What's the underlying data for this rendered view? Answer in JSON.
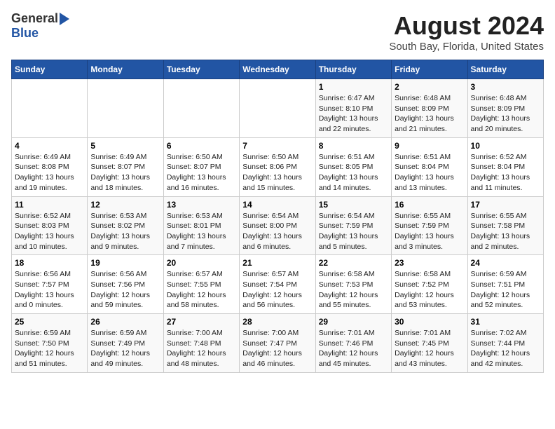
{
  "logo": {
    "general": "General",
    "blue": "Blue"
  },
  "title": "August 2024",
  "subtitle": "South Bay, Florida, United States",
  "days_of_week": [
    "Sunday",
    "Monday",
    "Tuesday",
    "Wednesday",
    "Thursday",
    "Friday",
    "Saturday"
  ],
  "weeks": [
    [
      {
        "day": "",
        "content": ""
      },
      {
        "day": "",
        "content": ""
      },
      {
        "day": "",
        "content": ""
      },
      {
        "day": "",
        "content": ""
      },
      {
        "day": "1",
        "content": "Sunrise: 6:47 AM\nSunset: 8:10 PM\nDaylight: 13 hours and 22 minutes."
      },
      {
        "day": "2",
        "content": "Sunrise: 6:48 AM\nSunset: 8:09 PM\nDaylight: 13 hours and 21 minutes."
      },
      {
        "day": "3",
        "content": "Sunrise: 6:48 AM\nSunset: 8:09 PM\nDaylight: 13 hours and 20 minutes."
      }
    ],
    [
      {
        "day": "4",
        "content": "Sunrise: 6:49 AM\nSunset: 8:08 PM\nDaylight: 13 hours and 19 minutes."
      },
      {
        "day": "5",
        "content": "Sunrise: 6:49 AM\nSunset: 8:07 PM\nDaylight: 13 hours and 18 minutes."
      },
      {
        "day": "6",
        "content": "Sunrise: 6:50 AM\nSunset: 8:07 PM\nDaylight: 13 hours and 16 minutes."
      },
      {
        "day": "7",
        "content": "Sunrise: 6:50 AM\nSunset: 8:06 PM\nDaylight: 13 hours and 15 minutes."
      },
      {
        "day": "8",
        "content": "Sunrise: 6:51 AM\nSunset: 8:05 PM\nDaylight: 13 hours and 14 minutes."
      },
      {
        "day": "9",
        "content": "Sunrise: 6:51 AM\nSunset: 8:04 PM\nDaylight: 13 hours and 13 minutes."
      },
      {
        "day": "10",
        "content": "Sunrise: 6:52 AM\nSunset: 8:04 PM\nDaylight: 13 hours and 11 minutes."
      }
    ],
    [
      {
        "day": "11",
        "content": "Sunrise: 6:52 AM\nSunset: 8:03 PM\nDaylight: 13 hours and 10 minutes."
      },
      {
        "day": "12",
        "content": "Sunrise: 6:53 AM\nSunset: 8:02 PM\nDaylight: 13 hours and 9 minutes."
      },
      {
        "day": "13",
        "content": "Sunrise: 6:53 AM\nSunset: 8:01 PM\nDaylight: 13 hours and 7 minutes."
      },
      {
        "day": "14",
        "content": "Sunrise: 6:54 AM\nSunset: 8:00 PM\nDaylight: 13 hours and 6 minutes."
      },
      {
        "day": "15",
        "content": "Sunrise: 6:54 AM\nSunset: 7:59 PM\nDaylight: 13 hours and 5 minutes."
      },
      {
        "day": "16",
        "content": "Sunrise: 6:55 AM\nSunset: 7:59 PM\nDaylight: 13 hours and 3 minutes."
      },
      {
        "day": "17",
        "content": "Sunrise: 6:55 AM\nSunset: 7:58 PM\nDaylight: 13 hours and 2 minutes."
      }
    ],
    [
      {
        "day": "18",
        "content": "Sunrise: 6:56 AM\nSunset: 7:57 PM\nDaylight: 13 hours and 0 minutes."
      },
      {
        "day": "19",
        "content": "Sunrise: 6:56 AM\nSunset: 7:56 PM\nDaylight: 12 hours and 59 minutes."
      },
      {
        "day": "20",
        "content": "Sunrise: 6:57 AM\nSunset: 7:55 PM\nDaylight: 12 hours and 58 minutes."
      },
      {
        "day": "21",
        "content": "Sunrise: 6:57 AM\nSunset: 7:54 PM\nDaylight: 12 hours and 56 minutes."
      },
      {
        "day": "22",
        "content": "Sunrise: 6:58 AM\nSunset: 7:53 PM\nDaylight: 12 hours and 55 minutes."
      },
      {
        "day": "23",
        "content": "Sunrise: 6:58 AM\nSunset: 7:52 PM\nDaylight: 12 hours and 53 minutes."
      },
      {
        "day": "24",
        "content": "Sunrise: 6:59 AM\nSunset: 7:51 PM\nDaylight: 12 hours and 52 minutes."
      }
    ],
    [
      {
        "day": "25",
        "content": "Sunrise: 6:59 AM\nSunset: 7:50 PM\nDaylight: 12 hours and 51 minutes."
      },
      {
        "day": "26",
        "content": "Sunrise: 6:59 AM\nSunset: 7:49 PM\nDaylight: 12 hours and 49 minutes."
      },
      {
        "day": "27",
        "content": "Sunrise: 7:00 AM\nSunset: 7:48 PM\nDaylight: 12 hours and 48 minutes."
      },
      {
        "day": "28",
        "content": "Sunrise: 7:00 AM\nSunset: 7:47 PM\nDaylight: 12 hours and 46 minutes."
      },
      {
        "day": "29",
        "content": "Sunrise: 7:01 AM\nSunset: 7:46 PM\nDaylight: 12 hours and 45 minutes."
      },
      {
        "day": "30",
        "content": "Sunrise: 7:01 AM\nSunset: 7:45 PM\nDaylight: 12 hours and 43 minutes."
      },
      {
        "day": "31",
        "content": "Sunrise: 7:02 AM\nSunset: 7:44 PM\nDaylight: 12 hours and 42 minutes."
      }
    ]
  ]
}
